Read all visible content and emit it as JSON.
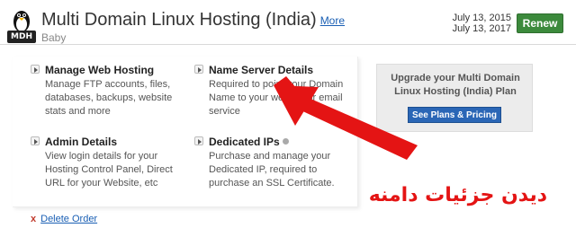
{
  "header": {
    "logo_text": "MDH",
    "title": "Multi Domain Linux Hosting (India)",
    "more_link": "More",
    "subtitle": "Baby",
    "start_date": "July 13, 2015",
    "end_date": "July 13, 2017",
    "renew_label": "Renew"
  },
  "items": [
    {
      "title": "Manage Web Hosting",
      "desc": "Manage FTP accounts, files, databases, backups, website stats and more"
    },
    {
      "title": "Name Server Details",
      "desc": "Required to point your Domain Name to your website or email service"
    },
    {
      "title": "Admin Details",
      "desc": "View login details for your Hosting Control Panel, Direct URL for your Website, etc"
    },
    {
      "title": "Dedicated IPs",
      "desc": "Purchase and manage your Dedicated IP, required to purchase an SSL Certificate."
    }
  ],
  "upgrade": {
    "text": "Upgrade your Multi Domain Linux Hosting (India) Plan",
    "button_label": "See Plans & Pricing"
  },
  "delete": {
    "x_mark": "x",
    "link_label": "Delete Order"
  },
  "annotation": {
    "text": "دیدن جزئیات دامنه",
    "color": "#e41414"
  },
  "colors": {
    "renew": "#3c8a3c",
    "plans_button": "#2a66b6",
    "link": "#1a5fb4"
  }
}
